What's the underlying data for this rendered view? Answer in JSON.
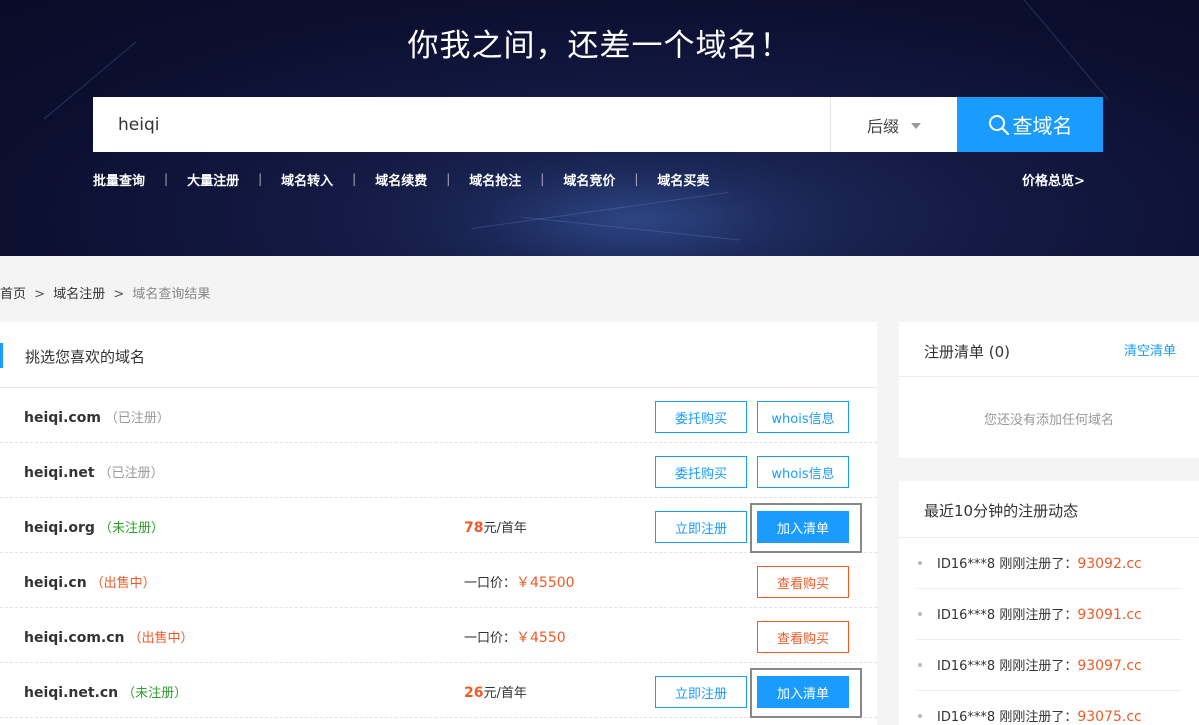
{
  "hero": {
    "title": "你我之间，还差一个域名！",
    "search_value": "heiqi",
    "suffix_label": "后缀",
    "search_button": "查域名",
    "quick_links": [
      "批量查询",
      "大量注册",
      "域名转入",
      "域名续费",
      "域名抢注",
      "域名竞价",
      "域名买卖"
    ],
    "separator": "|",
    "price_overview": "价格总览>"
  },
  "breadcrumb": {
    "home": "首页",
    "separator": ">",
    "register": "域名注册",
    "current": "域名查询结果"
  },
  "results": {
    "title": "挑选您喜欢的域名",
    "rows": [
      {
        "domain": "heiqi.com",
        "status": "（已注册）",
        "price": "",
        "unit": "",
        "fixed_label": "",
        "fixed_price": "",
        "left_button": "委托购买",
        "right_button": "whois信息"
      },
      {
        "domain": "heiqi.net",
        "status": "（已注册）",
        "price": "",
        "unit": "",
        "fixed_label": "",
        "fixed_price": "",
        "left_button": "委托购买",
        "right_button": "whois信息"
      },
      {
        "domain": "heiqi.org",
        "status": "（未注册）",
        "price": "78",
        "unit": "元/首年",
        "fixed_label": "",
        "fixed_price": "",
        "left_button": "立即注册",
        "right_button": "加入清单"
      },
      {
        "domain": "heiqi.cn",
        "status": "（出售中）",
        "price": "",
        "unit": "",
        "fixed_label": "一口价：",
        "fixed_price": "￥45500",
        "left_button": "",
        "right_button": "查看购买"
      },
      {
        "domain": "heiqi.com.cn",
        "status": "（出售中）",
        "price": "",
        "unit": "",
        "fixed_label": "一口价：",
        "fixed_price": "￥4550",
        "left_button": "",
        "right_button": "查看购买"
      },
      {
        "domain": "heiqi.net.cn",
        "status": "（未注册）",
        "price": "26",
        "unit": "元/首年",
        "fixed_label": "",
        "fixed_price": "",
        "left_button": "立即注册",
        "right_button": "加入清单"
      }
    ]
  },
  "cart": {
    "title": "注册清单 (0)",
    "clear": "清空清单",
    "empty_text": "您还没有添加任何域名"
  },
  "recent": {
    "title": "最近10分钟的注册动态",
    "items": [
      {
        "user": "ID16***8",
        "action": "刚刚注册了：",
        "domain": "93092.cc"
      },
      {
        "user": "ID16***8",
        "action": "刚刚注册了：",
        "domain": "93091.cc"
      },
      {
        "user": "ID16***8",
        "action": "刚刚注册了：",
        "domain": "93097.cc"
      },
      {
        "user": "ID16***8",
        "action": "刚刚注册了：",
        "domain": "93075.cc"
      }
    ]
  },
  "colors": {
    "accent": "#1a9cff",
    "sale": "#f05a28",
    "available": "#2da12d",
    "hero_bg": "#0c0f30"
  }
}
